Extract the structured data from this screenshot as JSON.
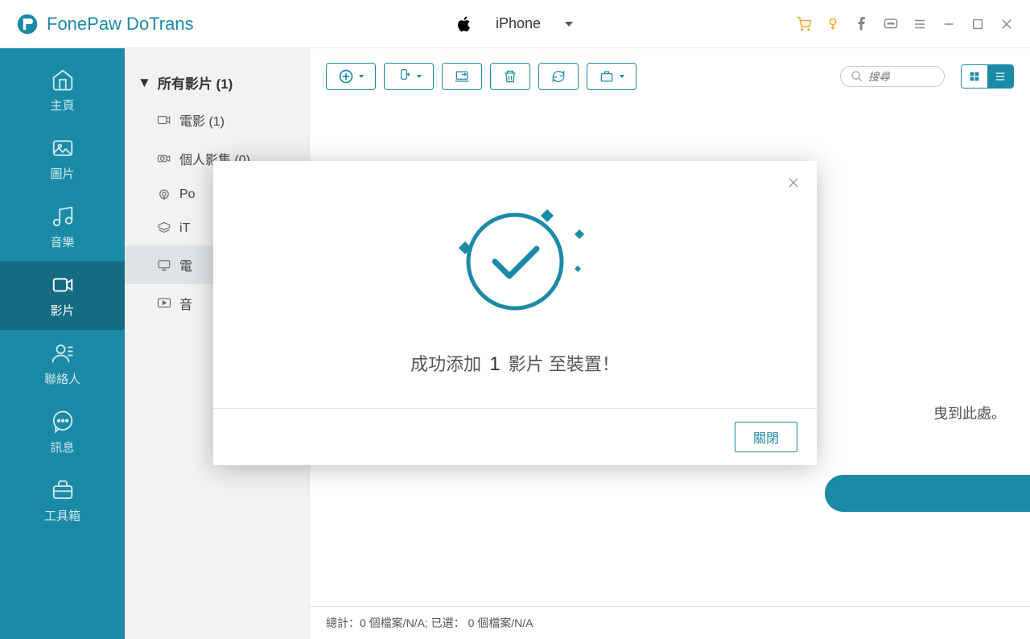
{
  "app": {
    "title": "FonePaw DoTrans"
  },
  "device": {
    "name": "iPhone"
  },
  "sidebar": {
    "items": [
      {
        "label": "主頁",
        "name": "home"
      },
      {
        "label": "圖片",
        "name": "photos"
      },
      {
        "label": "音樂",
        "name": "music"
      },
      {
        "label": "影片",
        "name": "videos"
      },
      {
        "label": "聯絡人",
        "name": "contacts"
      },
      {
        "label": "訊息",
        "name": "messages"
      },
      {
        "label": "工具箱",
        "name": "toolbox"
      }
    ],
    "active_index": 3
  },
  "categories": {
    "header": "所有影片 (1)",
    "items": [
      {
        "label": "電影 (1)",
        "icon": "video"
      },
      {
        "label": "個人影集 (0)",
        "icon": "camera"
      },
      {
        "label": "Po",
        "icon": "podcast"
      },
      {
        "label": "iT",
        "icon": "itunes"
      },
      {
        "label": "電",
        "icon": "tv"
      },
      {
        "label": "音",
        "icon": "music-video"
      }
    ],
    "selected_index": 4
  },
  "toolbar": {
    "search_placeholder": "搜尋"
  },
  "drop_hint": "曳到此處。",
  "status": "總計：0 個檔案/N/A; 已選： 0 個檔案/N/A",
  "modal": {
    "msg_prefix": "成功添加",
    "count": "1",
    "msg_mid": "影片",
    "msg_suffix": "至裝置！",
    "close_label": "關閉"
  }
}
